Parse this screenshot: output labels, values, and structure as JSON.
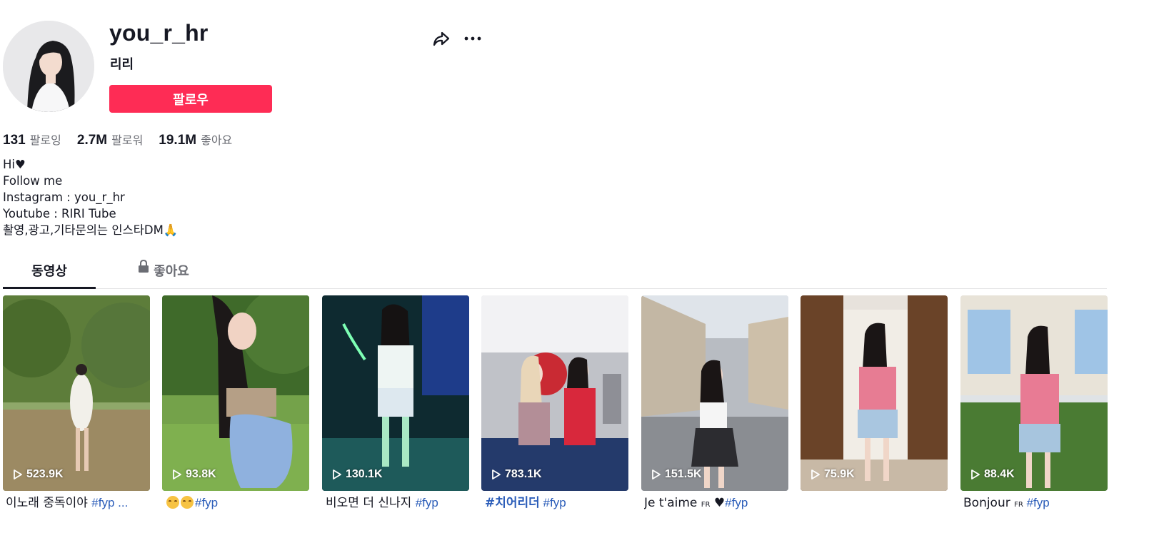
{
  "profile": {
    "username": "you_r_hr",
    "nickname": "리리",
    "follow_label": "팔로우"
  },
  "stats": [
    {
      "num": "131",
      "label": "팔로잉"
    },
    {
      "num": "2.7M",
      "label": "팔로워"
    },
    {
      "num": "19.1M",
      "label": "좋아요"
    }
  ],
  "bio": [
    "Hi♥",
    "Follow me",
    "Instagram : you_r_hr",
    "Youtube : RIRI Tube",
    "촬영,광고,기타문의는 인스타DM🙏"
  ],
  "tabs": {
    "videos": "동영상",
    "liked": "좋아요"
  },
  "videos": [
    {
      "views": "523.9K",
      "caption_text": "이노래 중독이야 ",
      "caption_tag": "#fyp ..."
    },
    {
      "views": "93.8K",
      "caption_text": "",
      "caption_tag": "#fyp"
    },
    {
      "views": "130.1K",
      "caption_text": "비오면 더 신나지 ",
      "caption_tag": "#fyp"
    },
    {
      "views": "783.1K",
      "caption_text": "",
      "caption_tag_bold": "#치어리더",
      "caption_tag": " #fyp"
    },
    {
      "views": "151.5K",
      "caption_text": "Je t'aime ",
      "caption_small": "FR",
      "caption_text2": " ♥",
      "caption_tag": "#fyp"
    },
    {
      "views": "75.9K",
      "caption_text": "",
      "caption_tag": ""
    },
    {
      "views": "88.4K",
      "caption_text": "Bonjour ",
      "caption_small": "FR",
      "caption_tag": " #fyp"
    }
  ],
  "icons": {
    "share": "share-icon",
    "more": "more-icon",
    "lock": "lock-icon",
    "play": "play-icon"
  },
  "colors": {
    "accent": "#fe2c55",
    "hashtag": "#2b5db9",
    "muted": "#6b6d74"
  }
}
